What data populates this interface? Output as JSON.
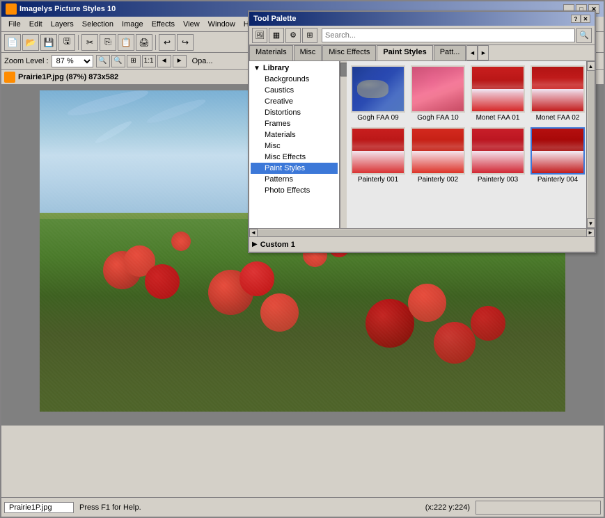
{
  "app": {
    "title": "Imagelys Picture Styles 10",
    "icon": "🎨"
  },
  "menu": {
    "items": [
      "File",
      "Edit",
      "Layers",
      "Selection",
      "Image",
      "Effects",
      "View",
      "Window",
      "H"
    ]
  },
  "toolbar": {
    "buttons": [
      "new",
      "open",
      "save",
      "save-as",
      "cut",
      "copy",
      "paste",
      "print",
      "undo",
      "redo"
    ]
  },
  "zoom": {
    "label": "Zoom Level :",
    "value": "87 %",
    "opacity_label": "Opa..."
  },
  "image": {
    "title": "Prairie1P.jpg (87%) 873x582"
  },
  "tool_palette": {
    "title": "Tool Palette",
    "tabs": [
      {
        "label": "Materials",
        "active": false
      },
      {
        "label": "Misc",
        "active": false
      },
      {
        "label": "Misc Effects",
        "active": false
      },
      {
        "label": "Paint Styles",
        "active": true
      },
      {
        "label": "Patt...",
        "active": false
      }
    ],
    "library": {
      "header": "Library",
      "items": [
        {
          "label": "Backgrounds",
          "indent": 1
        },
        {
          "label": "Caustics",
          "indent": 1
        },
        {
          "label": "Creative",
          "indent": 1
        },
        {
          "label": "Distortions",
          "indent": 1
        },
        {
          "label": "Frames",
          "indent": 1
        },
        {
          "label": "Materials",
          "indent": 1
        },
        {
          "label": "Misc",
          "indent": 1
        },
        {
          "label": "Misc Effects",
          "indent": 1
        },
        {
          "label": "Paint Styles",
          "indent": 1,
          "active": true
        },
        {
          "label": "Patterns",
          "indent": 1
        },
        {
          "label": "Photo Effects",
          "indent": 1
        }
      ],
      "custom_section": "Custom 1"
    },
    "thumbnails": [
      {
        "id": "gogh09",
        "label": "Gogh FAA 09",
        "selected": false,
        "style_class": "gogh09-bg"
      },
      {
        "id": "gogh10",
        "label": "Gogh FAA 10",
        "selected": false,
        "style_class": "gogh10-bg"
      },
      {
        "id": "monet01",
        "label": "Monet FAA 01",
        "selected": false,
        "style_class": "monet01-bg"
      },
      {
        "id": "monet02",
        "label": "Monet FAA 02",
        "selected": false,
        "style_class": "monet02-bg"
      },
      {
        "id": "painterly001",
        "label": "Painterly 001",
        "selected": false,
        "style_class": "p001-bg"
      },
      {
        "id": "painterly002",
        "label": "Painterly 002",
        "selected": false,
        "style_class": "p002-bg"
      },
      {
        "id": "painterly003",
        "label": "Painterly 003",
        "selected": false,
        "style_class": "p003-bg"
      },
      {
        "id": "painterly004",
        "label": "Painterly 004",
        "selected": true,
        "style_class": "p004-bg"
      }
    ]
  },
  "status": {
    "file": "Prairie1P.jpg",
    "help": "Press F1 for Help.",
    "coords": "(x:222 y:224)"
  },
  "colors": {
    "active_tab_bg": "#d4d0c8",
    "selected_border": "#3c78d8",
    "active_tree_bg": "#3c78d8"
  }
}
